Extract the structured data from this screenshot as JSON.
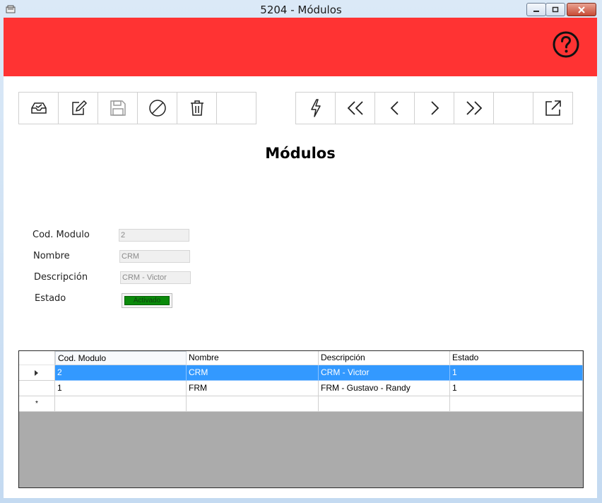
{
  "window": {
    "title": "5204 - Módulos",
    "controls": {
      "minimize_icon": "minimize-icon",
      "restore_icon": "restore-icon",
      "close_icon": "close-icon"
    }
  },
  "header": {
    "color": "#ff3333",
    "help_icon": "help-circle-icon"
  },
  "toolbar_left": [
    "inbox-icon",
    "edit-icon",
    "save-icon",
    "cancel-icon",
    "trash-icon",
    "empty"
  ],
  "toolbar_right": [
    "bolt-icon",
    "first-icon",
    "previous-icon",
    "next-icon",
    "last-icon",
    "empty",
    "export-icon"
  ],
  "page_title": "Módulos",
  "form": {
    "cod_label": "Cod. Modulo",
    "cod_value": "2",
    "nombre_label": "Nombre",
    "nombre_value": "CRM",
    "descripcion_label": "Descripción",
    "descripcion_value": "CRM - Victor",
    "estado_label": "Estado",
    "estado_value": "Activado",
    "estado_color": "#0a8a0a"
  },
  "grid": {
    "columns": [
      "Cod. Modulo",
      "Nombre",
      "Descripción",
      "Estado"
    ],
    "rows": [
      {
        "cells": [
          "2",
          "CRM",
          "CRM - Victor",
          "1"
        ],
        "selected": true
      },
      {
        "cells": [
          "1",
          "FRM",
          "FRM - Gustavo - Randy",
          "1"
        ],
        "selected": false
      }
    ],
    "new_row_marker": "*",
    "selection_color": "#3399ff"
  }
}
